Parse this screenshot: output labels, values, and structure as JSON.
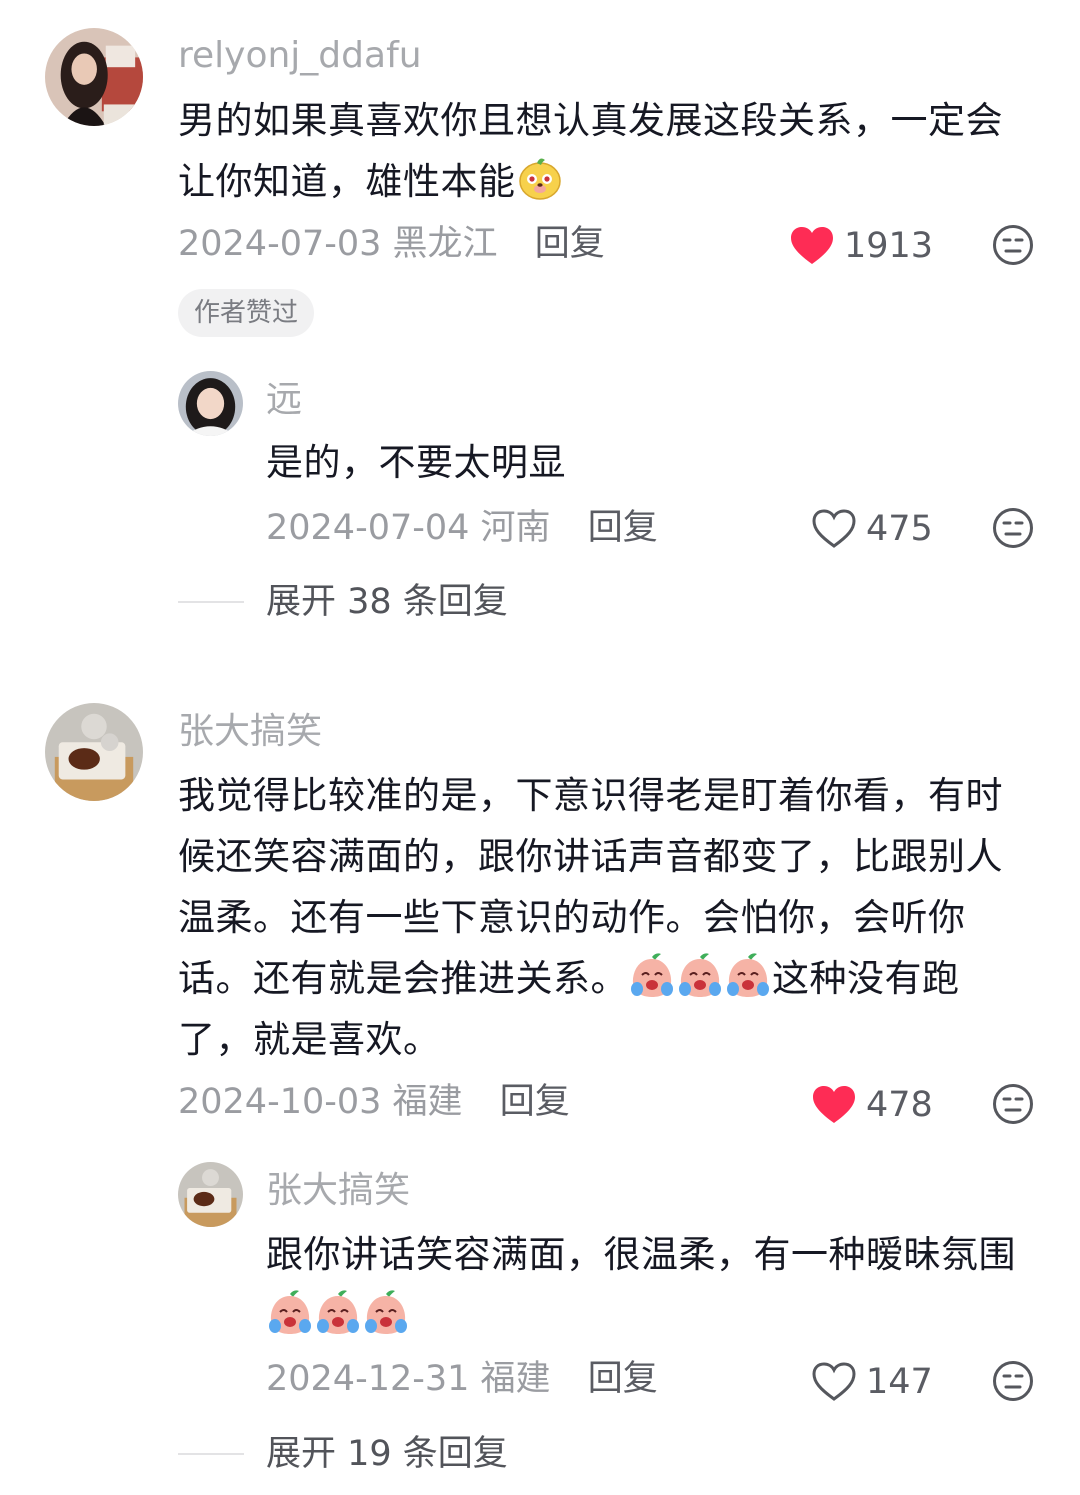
{
  "comments": [
    {
      "username": "relyonj_ddafu",
      "text_a": "男的如果真喜欢你且想认真发展这段关系，一定会",
      "text_b": "让你知道，雄性本能",
      "date": "2024-07-03",
      "location": "黑龙江",
      "reply_label": "回复",
      "likes": "1913",
      "liked": true,
      "badge": "作者赞过",
      "reply": {
        "username": "远",
        "text": "是的，不要太明显",
        "date": "2024-07-04",
        "location": "河南",
        "reply_label": "回复",
        "likes": "475",
        "liked": false
      },
      "expand_label": "展开 38 条回复"
    },
    {
      "username": "张大搞笑",
      "lines": [
        "我觉得比较准的是，下意识得老是盯着你看，有时",
        "候还笑容满面的，跟你讲话声音都变了，比跟别人",
        "温柔。还有一些下意识的动作。会怕你，会听你",
        "话。还有就是会推进关系。",
        "这种没有跑",
        "了，就是喜欢。"
      ],
      "date": "2024-10-03",
      "location": "福建",
      "reply_label": "回复",
      "likes": "478",
      "liked": true,
      "reply": {
        "username": "张大搞笑",
        "text": "跟你讲话笑容满面，很温柔，有一种暧昧氛围",
        "date": "2024-12-31",
        "location": "福建",
        "reply_label": "回复",
        "likes": "147",
        "liked": false
      },
      "expand_label": "展开 19 条回复"
    }
  ],
  "colors": {
    "heart_red": "#fe2c55",
    "meta_gray": "#9a9ca1",
    "text_dark": "#161823"
  },
  "icons": {
    "like": "heart-icon",
    "dislike": "neutral-face-icon",
    "emoji_1": "dog-emoji-icon",
    "emoji_2": "crying-peach-emoji-icon"
  }
}
